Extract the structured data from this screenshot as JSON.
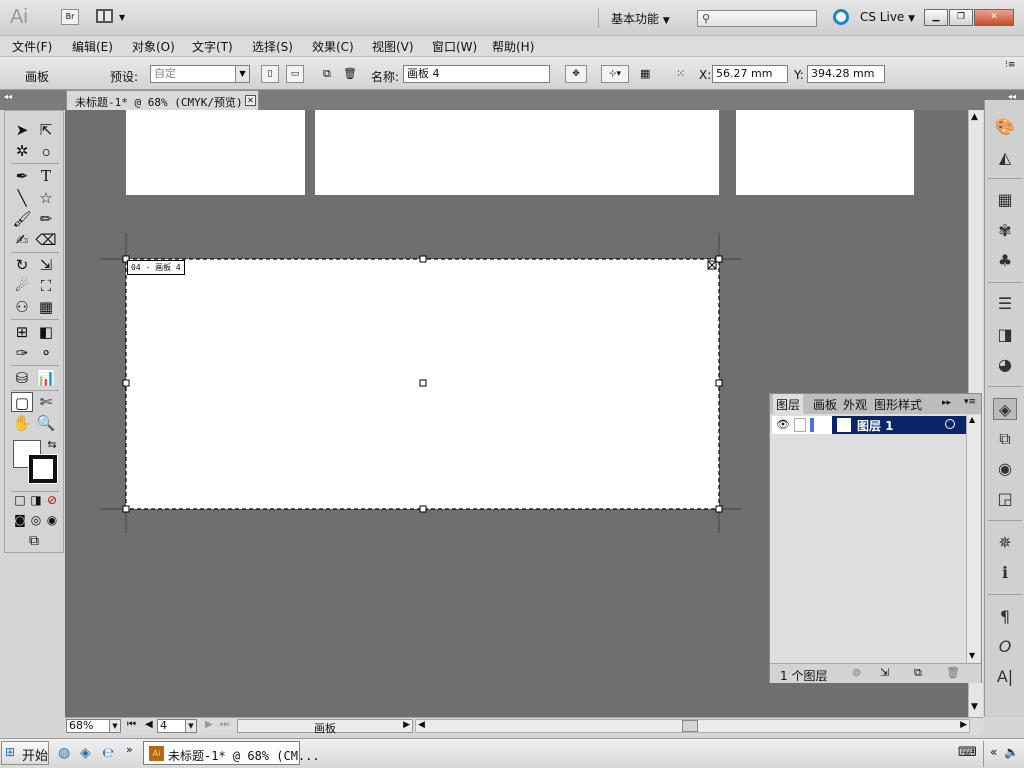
{
  "app": {
    "logo": "Ai",
    "bridge_label": "Br",
    "workspace": "基本功能",
    "cs_live": "CS Live"
  },
  "menu": [
    "文件(F)",
    "编辑(E)",
    "对象(O)",
    "文字(T)",
    "选择(S)",
    "效果(C)",
    "视图(V)",
    "窗口(W)",
    "帮助(H)"
  ],
  "control": {
    "mode_label": "画板",
    "preset_label": "预设:",
    "preset_value": "自定",
    "name_label": "名称:",
    "name_value": "画板 4",
    "x_label": "X:",
    "x_value": "56.27 mm",
    "y_label": "Y:",
    "y_value": "394.28 mm"
  },
  "document": {
    "tab_title": "未标题-1* @ 68% (CMYK/预览)",
    "artboard_label": "04 - 画板 4"
  },
  "layers_panel": {
    "tabs": [
      "图层",
      "画板",
      "外观",
      "图形样式"
    ],
    "layers": [
      {
        "name": "图层 1"
      }
    ],
    "count": "1 个图层"
  },
  "status": {
    "zoom": "68%",
    "page": "4",
    "label": "画板"
  },
  "taskbar": {
    "start": "开始",
    "task": "未标题-1* @ 68% (CM..."
  }
}
